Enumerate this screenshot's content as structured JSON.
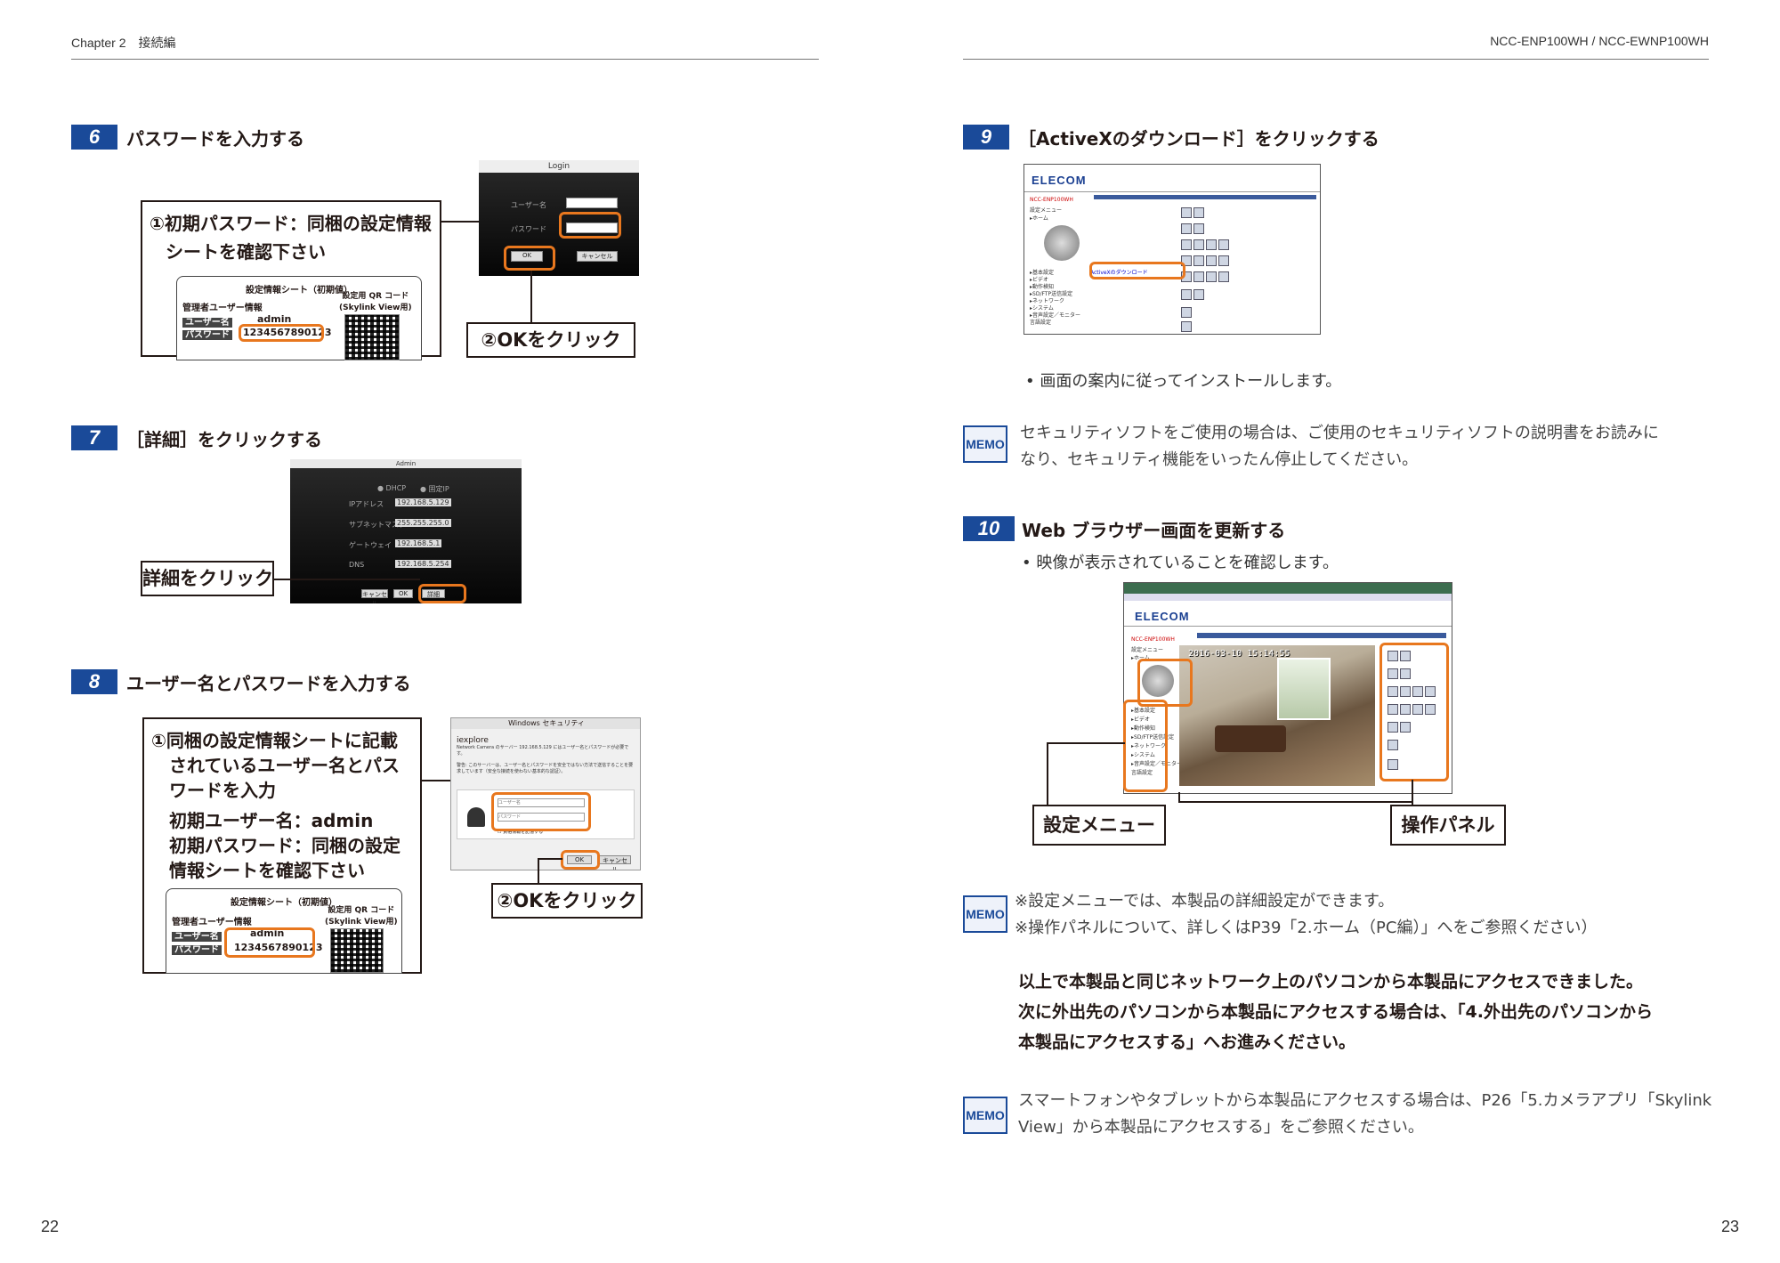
{
  "header": {
    "left": "Chapter 2　接続編",
    "right": "NCC-ENP100WH / NCC-EWNP100WH"
  },
  "page_numbers": {
    "left": "22",
    "right": "23"
  },
  "step6": {
    "num": "6",
    "title": "パスワードを入力する",
    "callout1_line1": "①初期パスワード：同梱の設定情報",
    "callout1_line2": "シートを確認下さい",
    "callout2": "②OKをクリック",
    "sheet": {
      "title": "設定情報シート（初期値）",
      "admin_label": "管理者ユーザー情報",
      "qr_label": "設定用 QR コード\n(Skylink View用)",
      "user_label": "ユーザー名",
      "user_value": "admin",
      "pass_label": "パスワード",
      "pass_value": "1234567890123"
    },
    "dialog": {
      "title": "Login",
      "user_field": "ユーザー名",
      "pass_field": "パスワード",
      "ok": "OK",
      "cancel": "キャンセル"
    }
  },
  "step7": {
    "num": "7",
    "title": "［詳細］をクリックする",
    "callout": "詳細をクリック",
    "dialog": {
      "title": "Admin",
      "dhcp": "DHCP",
      "fixed": "固定IP",
      "ip_label": "IPアドレス",
      "ip_value": "192.168.5.129",
      "subnet_label": "サブネットマスク",
      "subnet_value": "255.255.255.0",
      "gateway_label": "ゲートウェイ",
      "gateway_value": "192.168.5.1",
      "dns_label": "DNS",
      "dns_value": "192.168.5.254",
      "cancel": "キャンセル",
      "ok": "OK",
      "detail": "詳細"
    }
  },
  "step8": {
    "num": "8",
    "title": "ユーザー名とパスワードを入力する",
    "callout_lines": [
      "①同梱の設定情報シートに記載",
      "されているユーザー名とパス",
      "ワードを入力",
      "初期ユーザー名：admin",
      "初期パスワード：同梱の設定",
      "情報シートを確認下さい"
    ],
    "callout2": "②OKをクリック",
    "dialog": {
      "title": "Windows セキュリティ",
      "app": "iexplore",
      "msg1": "Network Camera のサーバー 192.168.5.129 にはユーザー名とパスワードが必要です。",
      "msg2": "警告: このサーバーは、ユーザー名とパスワードを安全ではない方法で送信することを要求しています（安全な接続を使わない基本的な認証）。",
      "user_placeholder": "ユーザー名",
      "pass_placeholder": "パスワード",
      "remember": "資格情報を記憶する",
      "ok": "OK",
      "cancel": "キャンセル"
    }
  },
  "step9": {
    "num": "9",
    "title": "［ActiveXのダウンロード］をクリックする",
    "note": "• 画面の案内に従ってインストールします。",
    "activex_link": "ActiveXのダウンロード"
  },
  "memo1": {
    "label": "MEMO",
    "line1": "セキュリティソフトをご使用の場合は、ご使用のセキュリティソフトの説明書をお読みに",
    "line2": "なり、セキュリティ機能をいったん停止してください。"
  },
  "step10": {
    "num": "10",
    "title": "Web ブラウザー画面を更新する",
    "note": "• 映像が表示されていることを確認します。",
    "callout_menu": "設定メニュー",
    "callout_panel": "操作パネル"
  },
  "webui": {
    "brand": "ELECOM",
    "model": "NCC-ENP100WH",
    "menu_title": "設定メニュー",
    "home": "▸ホーム",
    "menu_items": [
      "▸基本設定",
      "▸ビデオ",
      "▸動作検知",
      "▸SD/FTP送信設定",
      "▸ネットワーク",
      "▸システム",
      "▸音声設定／モニター",
      "言語設定"
    ],
    "timestamp": "2016-03-10 15:14:55"
  },
  "memo2": {
    "label": "MEMO",
    "line1": "※設定メニューでは、本製品の詳細設定ができます。",
    "line2": "※操作パネルについて、詳しくはP39「2.ホーム（PC編）」へをご参照ください）"
  },
  "summary": {
    "line1": "以上で本製品と同じネットワーク上のパソコンから本製品にアクセスできました。",
    "line2": "次に外出先のパソコンから本製品にアクセスする場合は、「4.外出先のパソコンから",
    "line3": "本製品にアクセスする」へお進みください。"
  },
  "memo3": {
    "label": "MEMO",
    "line1": "スマートフォンやタブレットから本製品にアクセスする場合は、P26「5.カメラアプリ「Skylink",
    "line2": "View」から本製品にアクセスする」をご参照ください。"
  },
  "colors": {
    "step_blue": "#1a4a99",
    "highlight_orange": "#e8771e"
  }
}
